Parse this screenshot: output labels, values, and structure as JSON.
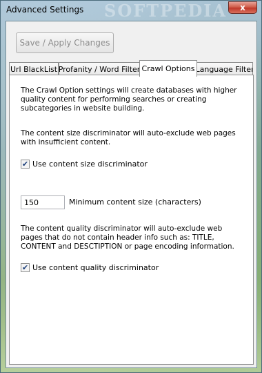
{
  "window": {
    "title": "Advanced Settings",
    "watermark": "SOFTPEDIA",
    "close_label": "x"
  },
  "toolbar": {
    "save_label": "Save / Apply Changes"
  },
  "tabs": [
    {
      "label": "Url BlackList",
      "active": false
    },
    {
      "label": "Profanity / Word Filter",
      "active": false
    },
    {
      "label": "Crawl Options",
      "active": true
    },
    {
      "label": "Language Filter",
      "active": false
    }
  ],
  "crawl": {
    "intro": "The Crawl Option settings will create databases with higher quality content for performing searches or creating subcategories in website building.",
    "size_desc": "The content size discriminator will auto-exclude web pages with insufficient content.",
    "size_check_label": "Use content size discriminator",
    "size_checked": true,
    "min_size_value": "150",
    "min_size_label": "Minimum content size (characters)",
    "quality_desc": "The content quality discriminator will auto-exclude web pages that do not contain header info such as: TITLE, CONTENT and DESCTIPTION or page encoding information.",
    "quality_check_label": "Use content quality discriminator",
    "quality_checked": true,
    "check_glyph": "✔"
  }
}
